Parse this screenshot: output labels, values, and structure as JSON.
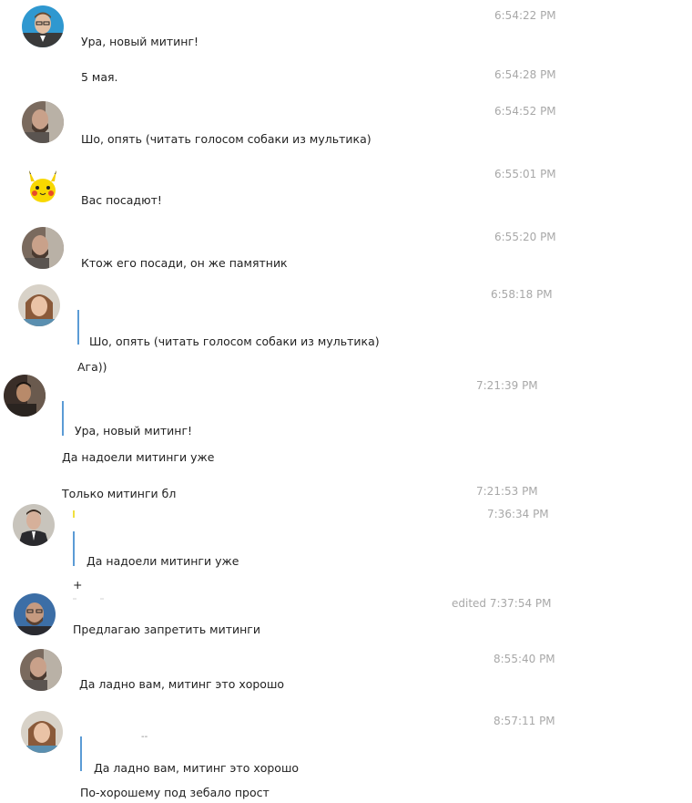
{
  "messages": [
    {
      "id": "m1",
      "avatar": "man-glasses-avatar",
      "time": "6:54:22 PM",
      "text": "Ура, новый митинг!"
    },
    {
      "id": "m1b",
      "time": "6:54:28 PM",
      "text": "5 мая."
    },
    {
      "id": "m2",
      "avatar": "bearded-man-avatar",
      "time": "6:54:52 PM",
      "text": "Шо, опять (читать голосом собаки из мультика)"
    },
    {
      "id": "m3",
      "avatar": "pikachu-avatar",
      "time": "6:55:01 PM",
      "text": "Вас посадют!"
    },
    {
      "id": "m4",
      "avatar": "bearded-man-avatar",
      "time": "6:55:20 PM",
      "text": "Ктож его посади, он же памятник"
    },
    {
      "id": "m5",
      "avatar": "woman-avatar",
      "time": "6:58:18 PM",
      "quote": "Шо, опять (читать голосом собаки из мультика)",
      "text": "Ага))"
    },
    {
      "id": "m6",
      "avatar": "dark-man-avatar",
      "time": "7:21:39 PM",
      "quote": "Ура, новый митинг!",
      "text": "Да надоели митинги уже"
    },
    {
      "id": "m6b",
      "time": "7:21:53 PM",
      "text": "Только митинги бл"
    },
    {
      "id": "m7",
      "avatar": "suit-man-avatar",
      "time": "7:36:34 PM",
      "quote": "Да надоели митинги уже",
      "text": "+"
    },
    {
      "id": "m8",
      "avatar": "bald-man-avatar",
      "time": "edited 7:37:54 PM",
      "text": "Предлагаю запретить митинги"
    },
    {
      "id": "m9",
      "avatar": "bearded-man-avatar",
      "time": "8:55:40 PM",
      "text": "Да ладно вам, митинг это хорошо"
    },
    {
      "id": "m10",
      "avatar": "woman-avatar",
      "time": "8:57:11 PM",
      "quote_mark": "--",
      "quote": "Да ладно вам, митинг это хорошо",
      "text": "По-хорошему под  зебало прост"
    }
  ],
  "colors": {
    "quote_bar": "#5b9bd5",
    "time": "#a8a8a8",
    "text": "#222222"
  }
}
